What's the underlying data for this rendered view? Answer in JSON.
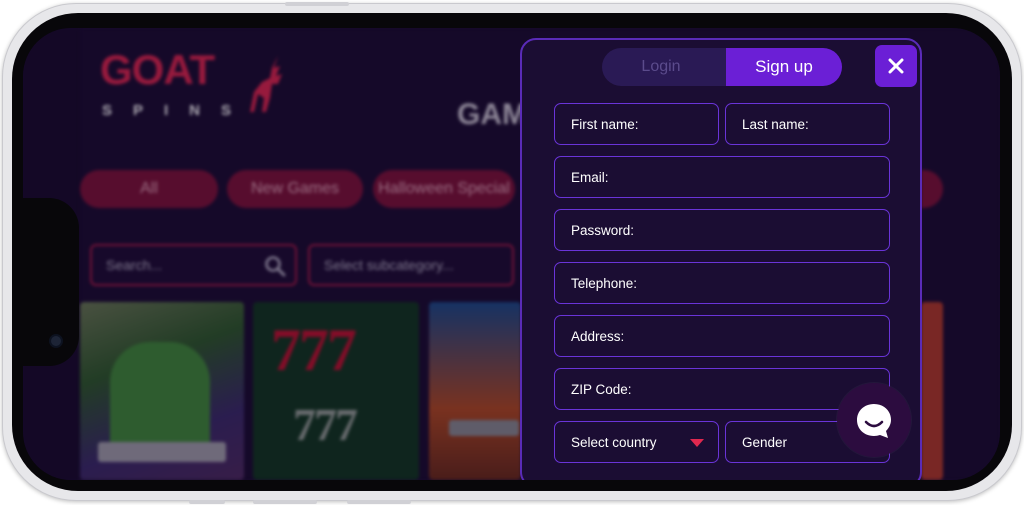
{
  "background_site": {
    "logo": {
      "word": "GOAT",
      "sub": "SPINS"
    },
    "section_title": "GAM",
    "categories": [
      "All",
      "New Games",
      "Halloween Special"
    ],
    "search": {
      "placeholder": "Search..."
    },
    "subcategory": {
      "placeholder": "Select subcategory..."
    },
    "tiles": [
      {
        "name": "game-tile-zombie"
      },
      {
        "name": "game-tile-777",
        "text_top": "777",
        "text_bottom": "777"
      },
      {
        "name": "game-tile-hero"
      }
    ]
  },
  "modal": {
    "tabs": {
      "login": "Login",
      "signup": "Sign up"
    },
    "active_tab": "signup",
    "close_icon": "close-icon",
    "fields": {
      "first_name": "First name:",
      "last_name": "Last name:",
      "email": "Email:",
      "password": "Password:",
      "telephone": "Telephone:",
      "address": "Address:",
      "zip": "ZIP Code:",
      "country": "Select country",
      "gender": "Gender"
    }
  },
  "colors": {
    "accent_purple": "#6b1fd6",
    "field_border": "#6a34d8",
    "brand_red": "#e1254f",
    "modal_bg": "#1b0d33"
  },
  "chat": {
    "icon": "chat-bubble-icon"
  }
}
